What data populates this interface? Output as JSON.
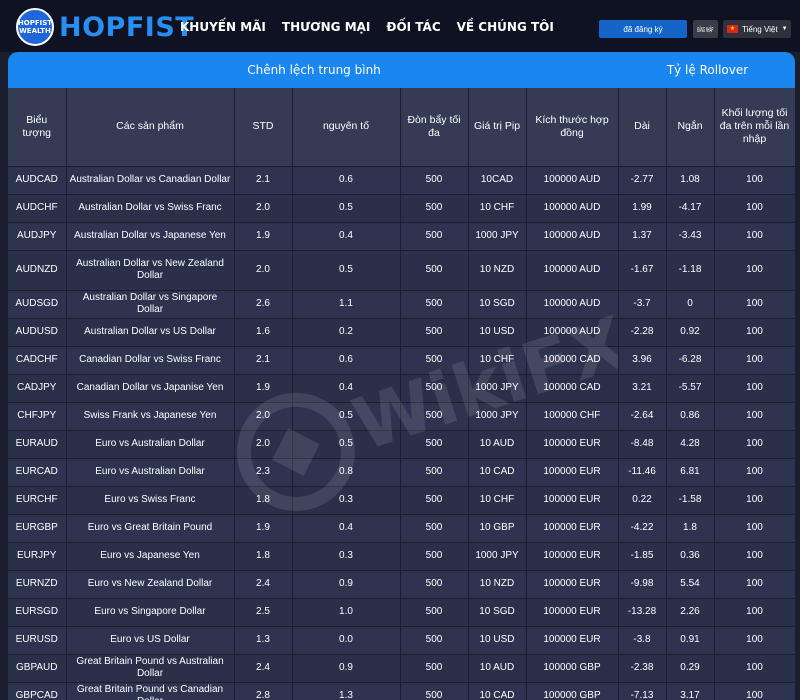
{
  "header": {
    "logo_badge": [
      "HOPFIST",
      "WEALTH"
    ],
    "logo_text": "HOPFIST",
    "nav": [
      "KHUYẾN MÃI",
      "THƯƠNG MẠI",
      "ĐỐI TÁC",
      "VỀ CHÚNG TÔI"
    ],
    "register_label": "đã đăng ký",
    "login_label": "ĐĂNG NHẬP",
    "language_label": "Tiếng Việt",
    "flag_icon": "vietnam-flag-icon",
    "chevron_icon": "chevron-down-icon"
  },
  "table": {
    "group_left": "Chênh lệch trung bình",
    "group_right": "Tỷ lệ Rollover",
    "columns": [
      "Biểu tượng",
      "Các sản phẩm",
      "STD",
      "nguyên tố",
      "Đòn bẩy tối đa",
      "Giá trị Pip",
      "Kích thước hợp đồng",
      "Dài",
      "Ngắn",
      "Khối lượng tối đa trên mỗi lần nhập"
    ],
    "rows": [
      [
        "AUDCAD",
        "Australian Dollar vs Canadian Dollar",
        "2.1",
        "0.6",
        "500",
        "10CAD",
        "100000 AUD",
        "-2.77",
        "1.08",
        "100"
      ],
      [
        "AUDCHF",
        "Australian Dollar vs Swiss Franc",
        "2.0",
        "0.5",
        "500",
        "10 CHF",
        "100000 AUD",
        "1.99",
        "-4.17",
        "100"
      ],
      [
        "AUDJPY",
        "Australian Dollar vs Japanese Yen",
        "1.9",
        "0.4",
        "500",
        "1000 JPY",
        "100000 AUD",
        "1.37",
        "-3.43",
        "100"
      ],
      [
        "AUDNZD",
        "Australian Dollar vs New Zealand Dollar",
        "2.0",
        "0.5",
        "500",
        "10 NZD",
        "100000 AUD",
        "-1.67",
        "-1.18",
        "100"
      ],
      [
        "AUDSGD",
        "Australian Dollar vs Singapore Dollar",
        "2.6",
        "1.1",
        "500",
        "10 SGD",
        "100000 AUD",
        "-3.7",
        "0",
        "100"
      ],
      [
        "AUDUSD",
        "Australian Dollar vs US Dollar",
        "1.6",
        "0.2",
        "500",
        "10 USD",
        "100000 AUD",
        "-2.28",
        "0.92",
        "100"
      ],
      [
        "CADCHF",
        "Canadian Dollar vs Swiss Franc",
        "2.1",
        "0.6",
        "500",
        "10 CHF",
        "100000 CAD",
        "3.96",
        "-6.28",
        "100"
      ],
      [
        "CADJPY",
        "Canadian Dollar vs Japanise Yen",
        "1.9",
        "0.4",
        "500",
        "1000 JPY",
        "100000 CAD",
        "3.21",
        "-5.57",
        "100"
      ],
      [
        "CHFJPY",
        "Swiss Frank vs Japanese Yen",
        "2.0",
        "0.5",
        "500",
        "1000 JPY",
        "100000 CHF",
        "-2.64",
        "0.86",
        "100"
      ],
      [
        "EURAUD",
        "Euro vs Australian Dollar",
        "2.0",
        "0.5",
        "500",
        "10 AUD",
        "100000 EUR",
        "-8.48",
        "4.28",
        "100"
      ],
      [
        "EURCAD",
        "Euro vs Australian Dollar",
        "2.3",
        "0.8",
        "500",
        "10 CAD",
        "100000 EUR",
        "-11.46",
        "6.81",
        "100"
      ],
      [
        "EURCHF",
        "Euro vs Swiss Franc",
        "1.8",
        "0.3",
        "500",
        "10 CHF",
        "100000 EUR",
        "0.22",
        "-1.58",
        "100"
      ],
      [
        "EURGBP",
        "Euro vs Great Britain Pound",
        "1.9",
        "0.4",
        "500",
        "10 GBP",
        "100000 EUR",
        "-4.22",
        "1.8",
        "100"
      ],
      [
        "EURJPY",
        "Euro vs Japanese Yen",
        "1.8",
        "0.3",
        "500",
        "1000 JPY",
        "100000 EUR",
        "-1.85",
        "0.36",
        "100"
      ],
      [
        "EURNZD",
        "Euro vs New Zealand Dollar",
        "2.4",
        "0.9",
        "500",
        "10 NZD",
        "100000 EUR",
        "-9.98",
        "5.54",
        "100"
      ],
      [
        "EURSGD",
        "Euro vs Singapore Dollar",
        "2.5",
        "1.0",
        "500",
        "10 SGD",
        "100000 EUR",
        "-13.28",
        "2.26",
        "100"
      ],
      [
        "EURUSD",
        "Euro vs US Dollar",
        "1.3",
        "0.0",
        "500",
        "10 USD",
        "100000 EUR",
        "-3.8",
        "0.91",
        "100"
      ],
      [
        "GBPAUD",
        "Great Britain Pound vs Australian Dollar",
        "2.4",
        "0.9",
        "500",
        "10 AUD",
        "100000 GBP",
        "-2.38",
        "0.29",
        "100"
      ],
      [
        "GBPCAD",
        "Great Britain Pound vs Canadian Dollar",
        "2.8",
        "1.3",
        "500",
        "10 CAD",
        "100000 GBP",
        "-7.13",
        "3.17",
        "100"
      ]
    ]
  },
  "watermark": {
    "text": "WikiFX",
    "icon": "wikifx-logo-icon"
  }
}
